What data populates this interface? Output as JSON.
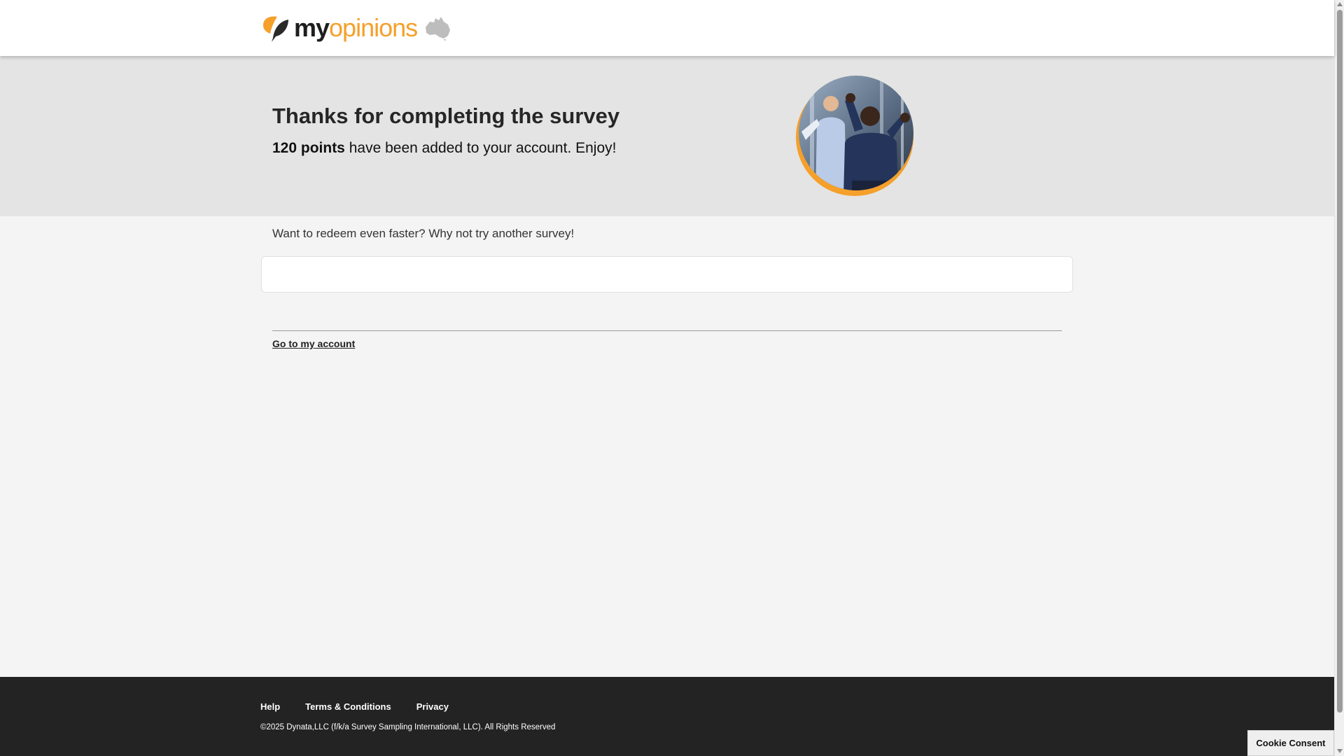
{
  "brand": {
    "name_part1": "my",
    "name_part2": "opinions",
    "accent_color": "#f5a02a",
    "mark_icon": "myopinions-leaf-logo",
    "region_icon": "australia-map-icon"
  },
  "hero": {
    "title": "Thanks for completing the survey",
    "points_text": "120 points",
    "message_rest": " have been added to your account. Enjoy!",
    "photo": "celebrating-people-photo"
  },
  "main": {
    "promo_text": "Want to redeem even faster? Why not try another survey!",
    "account_link": "Go to my account"
  },
  "footer": {
    "links": [
      "Help",
      "Terms & Conditions",
      "Privacy"
    ],
    "copyright": "©2025 Dynata,LLC (f/k/a Survey Sampling International, LLC). All Rights Reserved"
  },
  "cookie": {
    "label": "Cookie Consent"
  }
}
